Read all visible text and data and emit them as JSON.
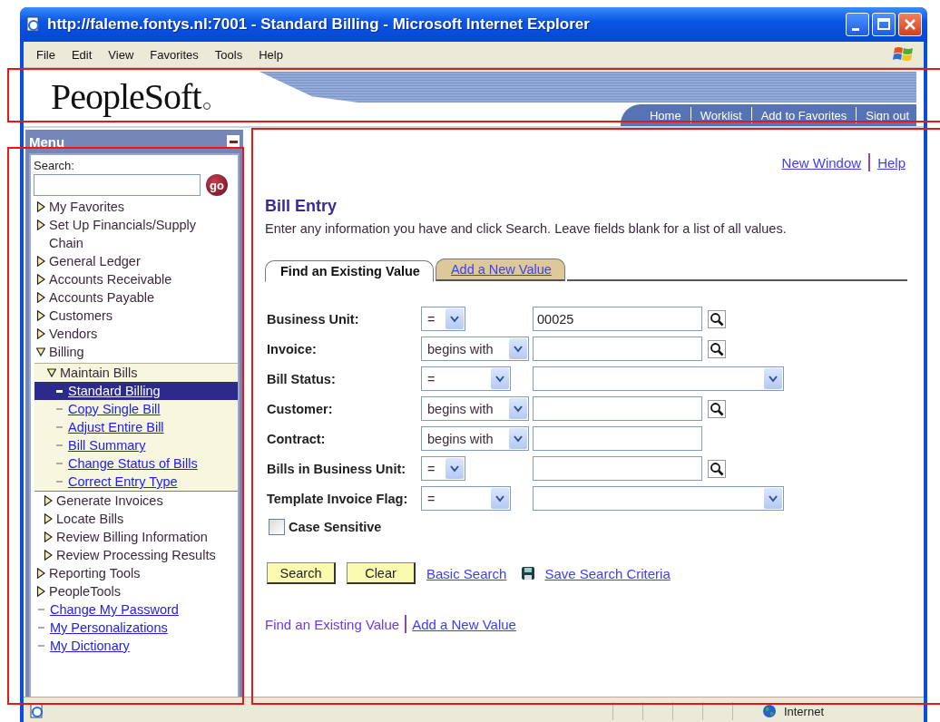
{
  "window": {
    "title": "http://faleme.fontys.nl:7001 - Standard Billing - Microsoft Internet Explorer"
  },
  "menu_bar": [
    "File",
    "Edit",
    "View",
    "Favorites",
    "Tools",
    "Help"
  ],
  "header": {
    "logo": "PeopleSoft",
    "links": [
      "Home",
      "Worklist",
      "Add to Favorites",
      "Sign out"
    ]
  },
  "sidebar": {
    "title": "Menu",
    "search_label": "Search:",
    "go_button": "go",
    "items": [
      {
        "label": "My Favorites",
        "kind": "folder",
        "expanded": false
      },
      {
        "label": "Set Up Financials/Supply Chain",
        "kind": "folder",
        "expanded": false
      },
      {
        "label": "General Ledger",
        "kind": "folder",
        "expanded": false
      },
      {
        "label": "Accounts Receivable",
        "kind": "folder",
        "expanded": false
      },
      {
        "label": "Accounts Payable",
        "kind": "folder",
        "expanded": false
      },
      {
        "label": "Customers",
        "kind": "folder",
        "expanded": false
      },
      {
        "label": "Vendors",
        "kind": "folder",
        "expanded": false
      },
      {
        "label": "Billing",
        "kind": "folder",
        "expanded": true,
        "children": [
          {
            "label": "Maintain Bills",
            "kind": "folder",
            "expanded": true,
            "children": [
              {
                "label": "Standard Billing",
                "kind": "link",
                "selected": true
              },
              {
                "label": "Copy Single Bill",
                "kind": "link",
                "selected": false
              },
              {
                "label": "Adjust Entire Bill",
                "kind": "link",
                "selected": false
              },
              {
                "label": "Bill Summary",
                "kind": "link",
                "selected": false
              },
              {
                "label": "Change Status of Bills",
                "kind": "link",
                "selected": false
              },
              {
                "label": "Correct Entry Type",
                "kind": "link",
                "selected": false
              }
            ]
          },
          {
            "label": "Generate Invoices",
            "kind": "folder",
            "expanded": false
          },
          {
            "label": "Locate Bills",
            "kind": "folder",
            "expanded": false
          },
          {
            "label": "Review Billing Information",
            "kind": "folder",
            "expanded": false
          },
          {
            "label": "Review Processing Results",
            "kind": "folder",
            "expanded": false
          }
        ]
      },
      {
        "label": "Reporting Tools",
        "kind": "folder",
        "expanded": false
      },
      {
        "label": "PeopleTools",
        "kind": "folder",
        "expanded": false
      },
      {
        "label": "Change My Password",
        "kind": "link",
        "selected": false
      },
      {
        "label": "My Personalizations",
        "kind": "link",
        "selected": false
      },
      {
        "label": "My Dictionary",
        "kind": "link",
        "selected": false
      }
    ]
  },
  "content": {
    "top_links": [
      "New Window",
      "Help"
    ],
    "title": "Bill Entry",
    "instructions": "Enter any information you have and click Search. Leave fields blank for a list of all values.",
    "tabs": [
      {
        "label": "Find an Existing Value",
        "selected": true
      },
      {
        "label": "Add a New Value",
        "selected": false
      }
    ],
    "criteria": [
      {
        "label": "Business Unit:",
        "operator": "=",
        "kind": "lookup",
        "value": "00025"
      },
      {
        "label": "Invoice:",
        "operator": "begins with",
        "kind": "lookup"
      },
      {
        "label": "Bill Status:",
        "operator": "=",
        "kind": "select"
      },
      {
        "label": "Customer:",
        "operator": "begins with",
        "kind": "lookup"
      },
      {
        "label": "Contract:",
        "operator": "begins with",
        "kind": "text"
      },
      {
        "label": "Bills in Business Unit:",
        "operator": "=",
        "kind": "lookup"
      },
      {
        "label": "Template Invoice Flag:",
        "operator": "=",
        "kind": "select"
      }
    ],
    "case_sensitive": {
      "label": "Case Sensitive",
      "checked": false
    },
    "buttons": [
      "Search",
      "Clear"
    ],
    "links": [
      "Basic Search",
      "Save Search Criteria"
    ],
    "bottom_links": [
      {
        "label": "Find an Existing Value",
        "selected": true
      },
      {
        "label": "Add a New Value",
        "selected": false
      }
    ]
  },
  "status_bar": {
    "zone": "Internet"
  },
  "annotations": [
    {
      "kind": "frame"
    },
    {
      "kind": "frame"
    },
    {
      "kind": "frame"
    }
  ]
}
